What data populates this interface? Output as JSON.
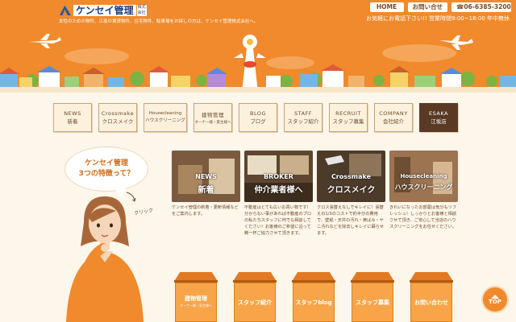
{
  "header": {
    "logo_text": "ケンセイ管理",
    "logo_small": "株式会社",
    "tagline": "女性のための物件、江坂の賃貸物件、住宅物件、駐車場をお探しの方は、ケンセイ管理株式会社へ。",
    "home_label": "HOME",
    "inquiry_label": "お問い合せ",
    "phone_label": "☎06-6385-3200",
    "contact_note": "お気軽にお電話下さい!! 営業時間9:00~18:00 年中無休"
  },
  "nav": [
    {
      "en": "NEWS",
      "jp": "新着"
    },
    {
      "en": "Crossmake",
      "jp": "クロスメイク"
    },
    {
      "en": "Housecleaning",
      "jp": "ハウスクリーニング"
    },
    {
      "en": "建物管理",
      "jp": "オーナー様・家主様へ"
    },
    {
      "en": "BLOG",
      "jp": "ブログ"
    },
    {
      "en": "STAFF",
      "jp": "スタッフ紹介"
    },
    {
      "en": "RECRUIT",
      "jp": "スタッフ募集"
    },
    {
      "en": "COMPANY",
      "jp": "会社紹介"
    },
    {
      "en": "ESAKA",
      "jp": "江坂店"
    }
  ],
  "bubble": {
    "line1": "ケンセイ管理",
    "line2": "3つの特徴って？"
  },
  "click_label": "クリック",
  "features": [
    {
      "title1": "NEWS",
      "title2": "新着",
      "desc": "ケンセイ管理の新着・更新情報などをご案内します。",
      "color": "#8a6a4a"
    },
    {
      "title1": "BROKER",
      "title2": "仲介業者様へ",
      "desc": "不動産はとても広いお買い物です！分からない事があれば不動産のプロの私たちスタッフに何でも相談してください！お客様のご希望に沿って精一杯ご協力させて頂きます。",
      "color": "#6e5238"
    },
    {
      "title1": "Crossmake",
      "title2": "クロスメイク",
      "desc": "クロス張替えなしでキレイに！張替えの1/3のコストで約半分の費用で、壁紙・天井の汚れ・黄ばみ・ヤニ汚れなどを除去しキレイに蘇らせます。",
      "color": "#5c4632"
    },
    {
      "title1": "Housecleaning",
      "title2": "ハウスクリーニング",
      "desc": "きれいになったお部屋は気分もリフレッシュ！しっかりとお客様と相談させて頂き、ご安心して当店のハウスクリーニングをお任せください。",
      "color": "#9c7452"
    }
  ],
  "houses": [
    {
      "label": "建物管理",
      "sub": "オーナー様・家主様へ"
    },
    {
      "label": "スタッフ紹介",
      "sub": ""
    },
    {
      "label": "スタッフblog",
      "sub": ""
    },
    {
      "label": "スタッフ募集",
      "sub": ""
    },
    {
      "label": "お問い合わせ",
      "sub": ""
    }
  ],
  "top_label": "TOP",
  "colors": {
    "header_orange": "#f08a2c",
    "cream": "#fdf6ea",
    "brown": "#5a3a24"
  }
}
